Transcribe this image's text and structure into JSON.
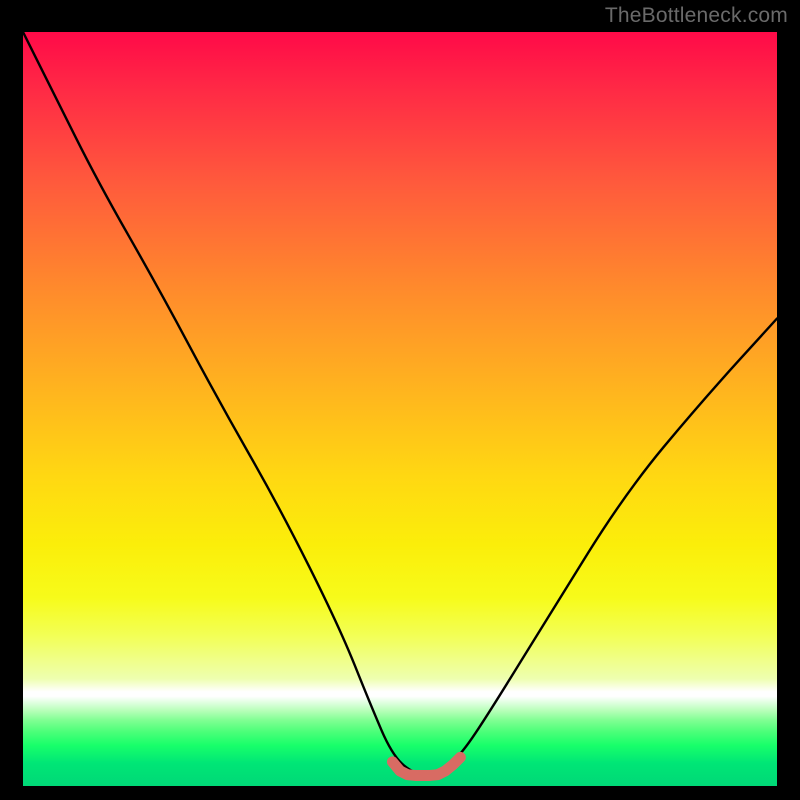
{
  "watermark": "TheBottleneck.com",
  "colors": {
    "frame": "#000000",
    "curve": "#000000",
    "marker": "#d86b63",
    "watermark": "#6a6a6a"
  },
  "chart_data": {
    "type": "line",
    "title": "",
    "xlabel": "",
    "ylabel": "",
    "xlim": [
      0,
      100
    ],
    "ylim": [
      0,
      100
    ],
    "grid": false,
    "legend": false,
    "annotations": [],
    "series": [
      {
        "name": "bottleneck-curve",
        "x": [
          0,
          4,
          10,
          18,
          26,
          34,
          42,
          46,
          49,
          52,
          55,
          58,
          62,
          70,
          80,
          90,
          100
        ],
        "y": [
          100,
          92,
          80,
          66,
          51,
          37,
          21,
          11,
          4,
          1.5,
          1.5,
          4,
          10,
          23,
          39,
          51,
          62
        ]
      }
    ],
    "markers": [
      {
        "name": "optimum-zone",
        "x": [
          49,
          50,
          51,
          52,
          53,
          54,
          55,
          56,
          57,
          58
        ],
        "y": [
          3.2,
          2.0,
          1.5,
          1.4,
          1.4,
          1.4,
          1.5,
          2.0,
          2.8,
          3.8
        ]
      }
    ],
    "gradient_stops": [
      {
        "pos": 0.0,
        "hex": "#ff0a48"
      },
      {
        "pos": 0.5,
        "hex": "#ffbb14"
      },
      {
        "pos": 0.75,
        "hex": "#f7fb1a"
      },
      {
        "pos": 0.88,
        "hex": "#ffffff"
      },
      {
        "pos": 0.92,
        "hex": "#6aff88"
      },
      {
        "pos": 1.0,
        "hex": "#00d877"
      }
    ]
  }
}
